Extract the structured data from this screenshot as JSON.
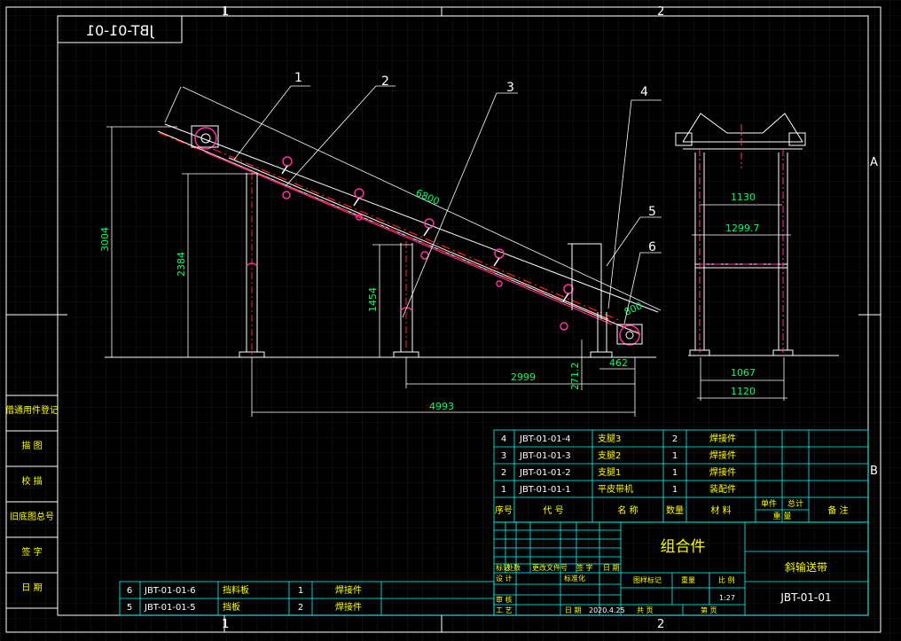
{
  "drawing_number_mirrored": "JBT-01-01",
  "border_zones": {
    "top": [
      "1",
      "2"
    ],
    "bottom": [
      "1",
      "2"
    ],
    "right": [
      "A",
      "B"
    ]
  },
  "side_stamps": [
    "借通用件登记",
    "描 图",
    "校 描",
    "旧底图总号",
    "签 字",
    "日 期"
  ],
  "callouts": [
    "1",
    "2",
    "3",
    "4",
    "5",
    "6"
  ],
  "dimensions": {
    "length_6800": "6800",
    "height_3004": "3004",
    "height_2384": "2384",
    "height_1454": "1454",
    "dim_2999": "2999",
    "dim_4993": "4993",
    "dim_462": "462",
    "dim_271_2": "271.2",
    "dim_800": "800",
    "width_1130": "1130",
    "width_1299_7": "1299.7",
    "width_1067": "1067",
    "width_1120": "1120"
  },
  "parts_table": {
    "rows": [
      {
        "no": "4",
        "code": "JBT-01-01-4",
        "name": "支腿3",
        "qty": "2",
        "note": "焊接件"
      },
      {
        "no": "3",
        "code": "JBT-01-01-3",
        "name": "支腿2",
        "qty": "1",
        "note": "焊接件"
      },
      {
        "no": "2",
        "code": "JBT-01-01-2",
        "name": "支腿1",
        "qty": "1",
        "note": "焊接件"
      },
      {
        "no": "1",
        "code": "JBT-01-01-1",
        "name": "平皮带机",
        "qty": "1",
        "note": "装配件"
      }
    ],
    "header": {
      "no": "序号",
      "code": "代 号",
      "name": "名 称",
      "qty": "数量",
      "material": "材 料",
      "unit_weight": "单件",
      "total_weight": "总计",
      "weight": "重 量",
      "remark": "备 注"
    }
  },
  "lower_table": {
    "rows": [
      {
        "no": "6",
        "code": "JBT-01-01-6",
        "name": "挡料板",
        "qty": "1",
        "note": "焊接件"
      },
      {
        "no": "5",
        "code": "JBT-01-01-5",
        "name": "挡板",
        "qty": "2",
        "note": "焊接件"
      }
    ]
  },
  "title_block": {
    "assembly": "组合件",
    "product_name": "斜输送带",
    "drawing_no": "JBT-01-01",
    "scale": "1:27",
    "date": "2020.4.25",
    "labels": {
      "mark": "标记",
      "count": "处数",
      "change_doc": "更改文件号",
      "sign": "签 字",
      "date_l": "日 期",
      "design": "设 计",
      "standard": "标准化",
      "stage_mark": "图样标记",
      "weight": "重量",
      "ratio": "比 例",
      "review": "审 核",
      "process": "工 艺",
      "date_b": "日 期",
      "total": "共 页",
      "page": "第 页"
    }
  }
}
